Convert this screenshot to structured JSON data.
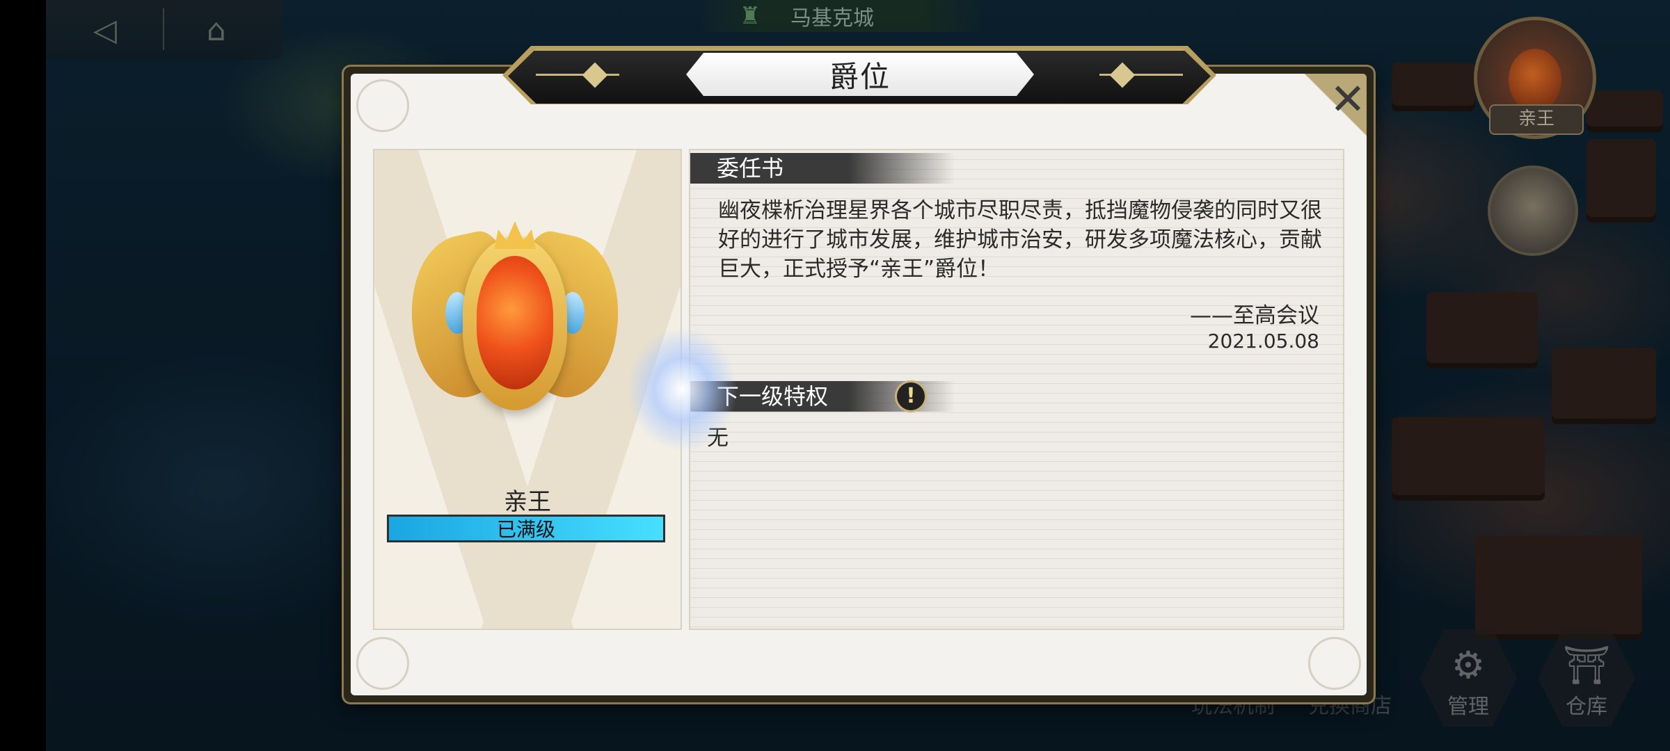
{
  "map": {
    "city_name": "马基克城",
    "bottom_buttons": [
      {
        "label": "管理",
        "icon": "gear-icon"
      },
      {
        "label": "仓库",
        "icon": "warehouse-icon"
      }
    ],
    "ghost_labels": [
      "玩法机制",
      "兑换商店"
    ],
    "avatar_label": "亲王"
  },
  "dialog": {
    "title": "爵位",
    "close_icon": "close-icon",
    "rank": {
      "name": "亲王",
      "status": "已满级",
      "progress": 1.0
    },
    "appointment": {
      "header": "委任书",
      "body": "幽夜楪析治理星界各个城市尽职尽责，抵挡魔物侵袭的同时又很好的进行了城市发展，维护城市治安，研发多项魔法核心，贡献巨大，正式授予“亲王”爵位！",
      "signature": "——至高会议",
      "date": "2021.05.08"
    },
    "next_privilege": {
      "header": "下一级特权",
      "info_icon": "!",
      "value": "无"
    }
  },
  "colors": {
    "accent_gold": "#b89f5e",
    "progress_fill": "#47dfff",
    "header_dark": "#3a3a3a"
  }
}
